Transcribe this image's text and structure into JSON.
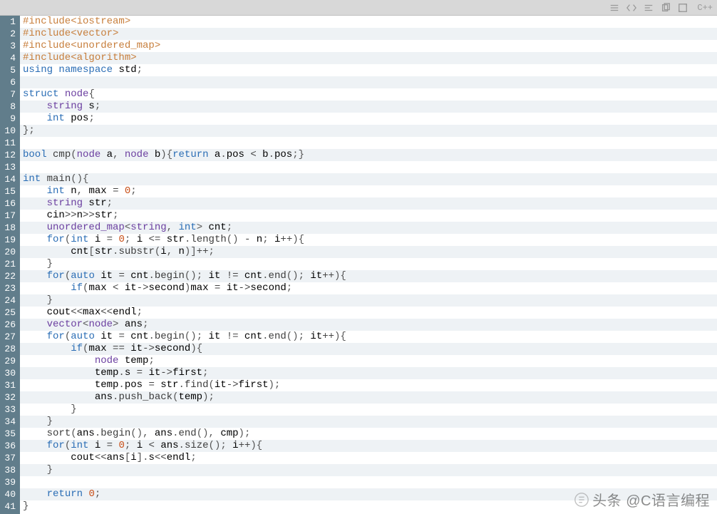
{
  "toolbar": {
    "language": "C++"
  },
  "watermark": "头条 @C语言编程",
  "code": {
    "lines": [
      {
        "n": 1,
        "html": "<span class='pp'>#include</span><span class='pp'>&lt;iostream&gt;</span>"
      },
      {
        "n": 2,
        "html": "<span class='pp'>#include</span><span class='pp'>&lt;vector&gt;</span>"
      },
      {
        "n": 3,
        "html": "<span class='pp'>#include</span><span class='pp'>&lt;unordered_map&gt;</span>"
      },
      {
        "n": 4,
        "html": "<span class='pp'>#include</span><span class='pp'>&lt;algorithm&gt;</span>"
      },
      {
        "n": 5,
        "html": "<span class='kw'>using</span> <span class='kw'>namespace</span> std<span class='punc'>;</span>"
      },
      {
        "n": 6,
        "html": ""
      },
      {
        "n": 7,
        "html": "<span class='kw'>struct</span> <span class='type'>node</span><span class='punc'>{</span>"
      },
      {
        "n": 8,
        "html": "    <span class='type'>string</span> s<span class='punc'>;</span>"
      },
      {
        "n": 9,
        "html": "    <span class='kw'>int</span> pos<span class='punc'>;</span>"
      },
      {
        "n": 10,
        "html": "<span class='punc'>};</span>"
      },
      {
        "n": 11,
        "html": ""
      },
      {
        "n": 12,
        "html": "<span class='kw'>bool</span> <span class='fn'>cmp</span><span class='punc'>(</span><span class='type'>node</span> a<span class='punc'>,</span> <span class='type'>node</span> b<span class='punc'>){</span><span class='kw'>return</span> a<span class='punc'>.</span>pos <span class='op'>&lt;</span> b<span class='punc'>.</span>pos<span class='punc'>;}</span>"
      },
      {
        "n": 13,
        "html": ""
      },
      {
        "n": 14,
        "html": "<span class='kw'>int</span> <span class='fn'>main</span><span class='punc'>(){</span>"
      },
      {
        "n": 15,
        "html": "    <span class='kw'>int</span> n<span class='punc'>,</span> max <span class='op'>=</span> <span class='num'>0</span><span class='punc'>;</span>"
      },
      {
        "n": 16,
        "html": "    <span class='type'>string</span> str<span class='punc'>;</span>"
      },
      {
        "n": 17,
        "html": "    cin<span class='op'>&gt;&gt;</span>n<span class='op'>&gt;&gt;</span>str<span class='punc'>;</span>"
      },
      {
        "n": 18,
        "html": "    <span class='type'>unordered_map</span><span class='punc'>&lt;</span><span class='type'>string</span><span class='punc'>,</span> <span class='kw'>int</span><span class='punc'>&gt;</span> cnt<span class='punc'>;</span>"
      },
      {
        "n": 19,
        "html": "    <span class='kw'>for</span><span class='punc'>(</span><span class='kw'>int</span> i <span class='op'>=</span> <span class='num'>0</span><span class='punc'>;</span> i <span class='op'>&lt;=</span> str<span class='punc'>.</span><span class='fn'>length</span><span class='punc'>()</span> <span class='op'>-</span> n<span class='punc'>;</span> i<span class='op'>++</span><span class='punc'>){</span>"
      },
      {
        "n": 20,
        "html": "        cnt<span class='punc'>[</span>str<span class='punc'>.</span><span class='fn'>substr</span><span class='punc'>(</span>i<span class='punc'>,</span> n<span class='punc'>)]</span><span class='op'>++</span><span class='punc'>;</span>"
      },
      {
        "n": 21,
        "html": "    <span class='punc'>}</span>"
      },
      {
        "n": 22,
        "html": "    <span class='kw'>for</span><span class='punc'>(</span><span class='kw'>auto</span> it <span class='op'>=</span> cnt<span class='punc'>.</span><span class='fn'>begin</span><span class='punc'>();</span> it <span class='op'>!=</span> cnt<span class='punc'>.</span><span class='fn'>end</span><span class='punc'>();</span> it<span class='op'>++</span><span class='punc'>){</span>"
      },
      {
        "n": 23,
        "html": "        <span class='kw'>if</span><span class='punc'>(</span>max <span class='op'>&lt;</span> it<span class='op'>-&gt;</span>second<span class='punc'>)</span>max <span class='op'>=</span> it<span class='op'>-&gt;</span>second<span class='punc'>;</span>"
      },
      {
        "n": 24,
        "html": "    <span class='punc'>}</span>"
      },
      {
        "n": 25,
        "html": "    cout<span class='op'>&lt;&lt;</span>max<span class='op'>&lt;&lt;</span>endl<span class='punc'>;</span>"
      },
      {
        "n": 26,
        "html": "    <span class='type'>vector</span><span class='punc'>&lt;</span><span class='type'>node</span><span class='punc'>&gt;</span> ans<span class='punc'>;</span>"
      },
      {
        "n": 27,
        "html": "    <span class='kw'>for</span><span class='punc'>(</span><span class='kw'>auto</span> it <span class='op'>=</span> cnt<span class='punc'>.</span><span class='fn'>begin</span><span class='punc'>();</span> it <span class='op'>!=</span> cnt<span class='punc'>.</span><span class='fn'>end</span><span class='punc'>();</span> it<span class='op'>++</span><span class='punc'>){</span>"
      },
      {
        "n": 28,
        "html": "        <span class='kw'>if</span><span class='punc'>(</span>max <span class='op'>==</span> it<span class='op'>-&gt;</span>second<span class='punc'>){</span>"
      },
      {
        "n": 29,
        "html": "            <span class='type'>node</span> temp<span class='punc'>;</span>"
      },
      {
        "n": 30,
        "html": "            temp<span class='punc'>.</span>s <span class='op'>=</span> it<span class='op'>-&gt;</span>first<span class='punc'>;</span>"
      },
      {
        "n": 31,
        "html": "            temp<span class='punc'>.</span>pos <span class='op'>=</span> str<span class='punc'>.</span><span class='fn'>find</span><span class='punc'>(</span>it<span class='op'>-&gt;</span>first<span class='punc'>);</span>"
      },
      {
        "n": 32,
        "html": "            ans<span class='punc'>.</span><span class='fn'>push_back</span><span class='punc'>(</span>temp<span class='punc'>);</span>"
      },
      {
        "n": 33,
        "html": "        <span class='punc'>}</span>"
      },
      {
        "n": 34,
        "html": "    <span class='punc'>}</span>"
      },
      {
        "n": 35,
        "html": "    <span class='fn'>sort</span><span class='punc'>(</span>ans<span class='punc'>.</span><span class='fn'>begin</span><span class='punc'>(),</span> ans<span class='punc'>.</span><span class='fn'>end</span><span class='punc'>(),</span> cmp<span class='punc'>);</span>"
      },
      {
        "n": 36,
        "html": "    <span class='kw'>for</span><span class='punc'>(</span><span class='kw'>int</span> i <span class='op'>=</span> <span class='num'>0</span><span class='punc'>;</span> i <span class='op'>&lt;</span> ans<span class='punc'>.</span><span class='fn'>size</span><span class='punc'>();</span> i<span class='op'>++</span><span class='punc'>){</span>"
      },
      {
        "n": 37,
        "html": "        cout<span class='op'>&lt;&lt;</span>ans<span class='punc'>[</span>i<span class='punc'>].</span>s<span class='op'>&lt;&lt;</span>endl<span class='punc'>;</span>"
      },
      {
        "n": 38,
        "html": "    <span class='punc'>}</span>"
      },
      {
        "n": 39,
        "html": ""
      },
      {
        "n": 40,
        "html": "    <span class='kw'>return</span> <span class='num'>0</span><span class='punc'>;</span>"
      },
      {
        "n": 41,
        "html": "<span class='punc'>}</span>"
      }
    ]
  }
}
